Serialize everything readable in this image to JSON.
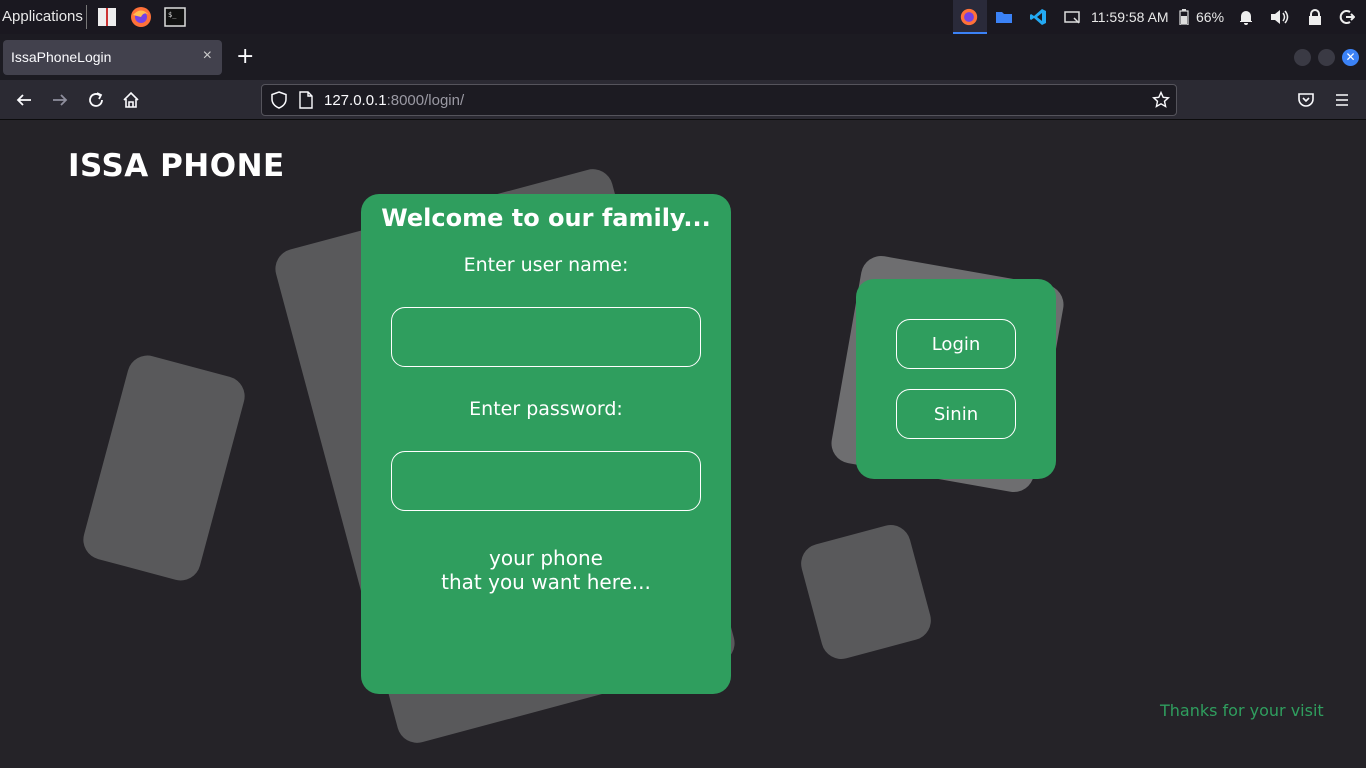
{
  "system_panel": {
    "applications_label": "Applications",
    "clock": "11:59:58 AM",
    "battery": "66%"
  },
  "browser": {
    "tab_title": "IssaPhoneLogin",
    "tab_close": "×",
    "new_tab": "+",
    "url_host": "127.0.0.1",
    "url_rest": ":8000/login/"
  },
  "page": {
    "brand": "ISSA PHONE",
    "login": {
      "welcome": "Welcome to our family...",
      "username_label": "Enter user name:",
      "password_label": "Enter password:",
      "tagline_line1": "your phone",
      "tagline_line2": "that you want here..."
    },
    "actions": {
      "login_button": "Login",
      "signin_button": "Sinin"
    },
    "footer": "Thanks for your visit"
  },
  "colors": {
    "accent_green": "#2f9e5e",
    "page_background": "#252328",
    "shape_gray": "#59595b"
  }
}
